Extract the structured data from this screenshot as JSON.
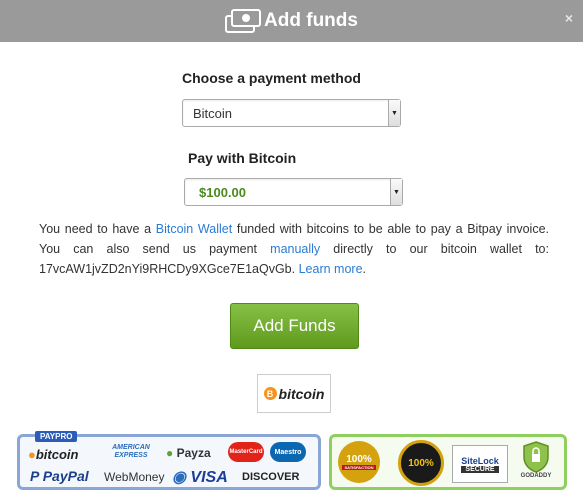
{
  "header": {
    "title": "Add funds",
    "close_symbol": "×"
  },
  "payment_method": {
    "label": "Choose a payment method",
    "selected": "Bitcoin"
  },
  "amount": {
    "label": "Pay with Bitcoin",
    "selected": "$100.00"
  },
  "info": {
    "text1": "You need to have a ",
    "link_wallet": "Bitcoin Wallet",
    "text2": " funded with bitcoins to be able to pay a Bitpay invoice. You can also send us payment ",
    "link_manually": "manually",
    "text3": " directly to our bitcoin wallet to: 17vcAW1jvZD2nYi9RHCDy9XGce7E1aQvGb. ",
    "link_learn": "Learn more",
    "text4": "."
  },
  "add_button": {
    "label": "Add Funds"
  },
  "bitcoin_badge": {
    "coin": "B",
    "text": "bitcoin"
  },
  "payment_logos": {
    "paypro": "PAYPRO",
    "bitcoin": "bitcoin",
    "amex": "AMERICAN EXPRESS",
    "payza": "Payza",
    "mastercard": "MasterCard",
    "maestro": "Maestro",
    "paypal": "PayPal",
    "webmoney": "WebMoney",
    "visa": "VISA",
    "discover": "DISCOVER"
  },
  "trust_logos": {
    "satisfaction": "100%",
    "satisfaction_sub": "SATISFACTION",
    "guarantee": "100%",
    "sitelock": "SiteLock",
    "sitelock_sub": "SECURE",
    "godaddy": "GODADDY"
  },
  "colors": {
    "header_bg": "#9a9a9a",
    "button_green": "#6fab2b",
    "link": "#2a7bd3",
    "amount_green": "#4b8a1d"
  }
}
